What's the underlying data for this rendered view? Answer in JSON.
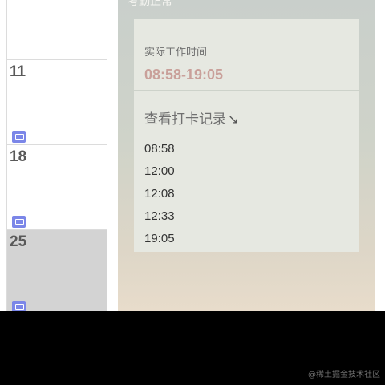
{
  "calendar": {
    "weeks": [
      {
        "day": "",
        "has_badge": false,
        "highlighted": false
      },
      {
        "day": "11",
        "has_badge": true,
        "highlighted": false
      },
      {
        "day": "18",
        "has_badge": true,
        "highlighted": false
      },
      {
        "day": "25",
        "has_badge": true,
        "highlighted": true
      }
    ],
    "badge_icon": "monitor-icon",
    "badge_color": "#7b86e8",
    "highlight_color": "#d3d3d3"
  },
  "detail": {
    "status_title": "考勤正常",
    "work_time_label": "实际工作时间",
    "work_time_value": "08:58-19:05",
    "work_time_color": "#c9a09a",
    "records_link": "查看打卡记录",
    "records_arrow": "↘",
    "punch_records": [
      "08:58",
      "12:00",
      "12:08",
      "12:33",
      "19:05"
    ]
  },
  "watermark": "@稀土掘金技术社区"
}
